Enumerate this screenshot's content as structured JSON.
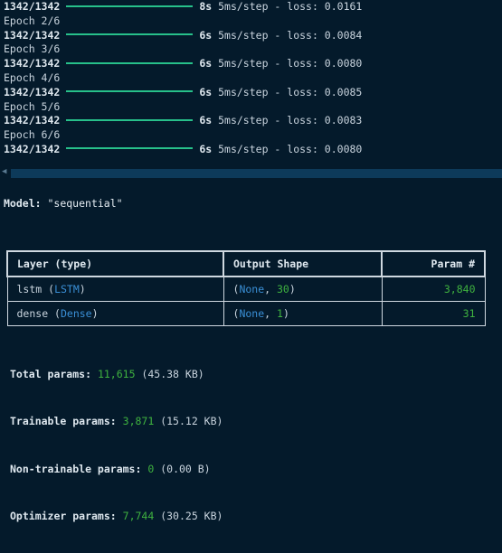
{
  "training_log": [
    {
      "type": "progress",
      "step": "1342/1342",
      "time": "8s",
      "rest": "5ms/step - loss: 0.0161"
    },
    {
      "type": "epoch",
      "text": "Epoch 2/6"
    },
    {
      "type": "progress",
      "step": "1342/1342",
      "time": "6s",
      "rest": "5ms/step - loss: 0.0084"
    },
    {
      "type": "epoch",
      "text": "Epoch 3/6"
    },
    {
      "type": "progress",
      "step": "1342/1342",
      "time": "6s",
      "rest": "5ms/step - loss: 0.0080"
    },
    {
      "type": "epoch",
      "text": "Epoch 4/6"
    },
    {
      "type": "progress",
      "step": "1342/1342",
      "time": "6s",
      "rest": "5ms/step - loss: 0.0085"
    },
    {
      "type": "epoch",
      "text": "Epoch 5/6"
    },
    {
      "type": "progress",
      "step": "1342/1342",
      "time": "6s",
      "rest": "5ms/step - loss: 0.0083"
    },
    {
      "type": "epoch",
      "text": "Epoch 6/6"
    },
    {
      "type": "progress",
      "step": "1342/1342",
      "time": "6s",
      "rest": "5ms/step - loss: 0.0080"
    }
  ],
  "model": {
    "label": "Model:",
    "name": "\"sequential\""
  },
  "summary_table": {
    "headers": {
      "layer": "Layer (type)",
      "shape": "Output Shape",
      "params": "Param #"
    },
    "rows": [
      {
        "name": "lstm",
        "type": "LSTM",
        "shape_none": "None",
        "shape_dim": "30",
        "params": "3,840"
      },
      {
        "name": "dense",
        "type": "Dense",
        "shape_none": "None",
        "shape_dim": "1",
        "params": "31"
      }
    ]
  },
  "totals": {
    "total": {
      "label": "Total params:",
      "value": "11,615",
      "size": "(45.38 KB)"
    },
    "trainable": {
      "label": "Trainable params:",
      "value": "3,871",
      "size": "(15.12 KB)"
    },
    "non_trainable": {
      "label": "Non-trainable params:",
      "value": "0",
      "size": "(0.00 B)"
    },
    "optimizer": {
      "label": "Optimizer params:",
      "value": "7,744",
      "size": "(30.25 KB)"
    }
  },
  "colors": {
    "background": "#041a2b",
    "progress_bar": "#27c08a",
    "type_blue": "#3a8fd6",
    "number_green": "#3fb23f"
  }
}
